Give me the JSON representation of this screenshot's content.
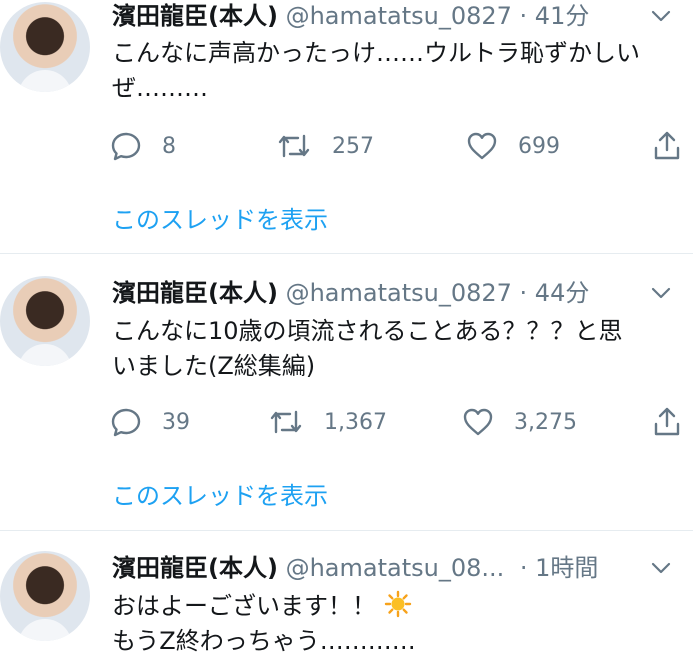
{
  "tweets": [
    {
      "name": "濱田龍臣(本人)",
      "handle": "@hamatatsu_0827",
      "time": "· 41分",
      "lines": [
        "こんなに声高かったっけ……ウルトラ恥ずかしい",
        "ぜ………"
      ],
      "reply_count": "8",
      "retweet_count": "257",
      "like_count": "699",
      "thread_link": "このスレッドを表示"
    },
    {
      "name": "濱田龍臣(本人)",
      "handle": "@hamatatsu_0827",
      "time": "· 44分",
      "lines": [
        "こんなに10歳の頃流されることある？？？と思",
        "いました(Z総集編)"
      ],
      "reply_count": "39",
      "retweet_count": "1,367",
      "like_count": "3,275",
      "thread_link": "このスレッドを表示"
    },
    {
      "name": "濱田龍臣(本人)",
      "handle": "@hamatatsu_08...",
      "time": "· 1時間",
      "lines": [
        "おはよーございます！！",
        "もうZ終わっちゃう…………"
      ]
    }
  ],
  "colors": {
    "link": "#1da1f2",
    "secondary": "#657786",
    "divider": "#e6ecf0"
  },
  "icons": [
    "reply-icon",
    "retweet-icon",
    "like-icon",
    "share-icon",
    "chevron-down-icon",
    "sun-emoji-icon"
  ]
}
